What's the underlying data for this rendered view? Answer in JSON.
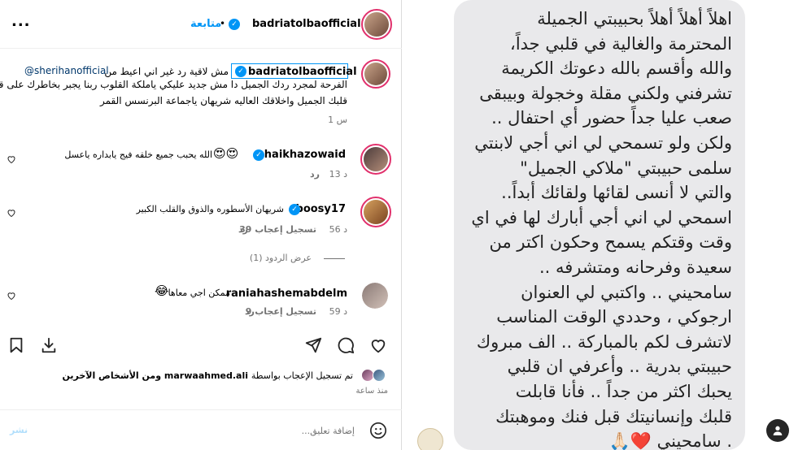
{
  "header": {
    "username": "badriatolbaofficial",
    "follow_label": "متابعة",
    "separator": "•",
    "more": "..."
  },
  "caption": {
    "username": "badriatolbaofficial",
    "mention": "@sherihanofficial",
    "line1": "مش لاقية رد غير اني اعيط من",
    "line2": "الفرحة لمجرد ردك الجميل دا مش جديد عليكي ياملكة القلوب ربنا يجبر بخاطرك على قد",
    "line3": "قلبك الجميل واخلاقك العاليه شريهان ياجماعة البرنسس القمر",
    "time": "1 س"
  },
  "comments": [
    {
      "username": "shaikhazowaid",
      "text": "الله يحبب جميع خلقه فيج يابداره ياعسل",
      "emoji": "😍😍",
      "time": "13 د",
      "reply": "رد",
      "likes": ""
    },
    {
      "username": "boosy17",
      "text": "شريهان الأسطوره والذوق والقلب الكبير",
      "emoji": "",
      "time": "56 د",
      "likes": "39 تسجيل إعجاب",
      "reply": "رد",
      "view_replies": "عرض الردود (1)"
    },
    {
      "username": "raniahashemabdelm",
      "text": "ممكن اجي معاها",
      "emoji": "😂",
      "time": "59 د",
      "likes": "9 تسجيل إعجاب",
      "reply": "رد"
    }
  ],
  "likes": {
    "prefix": "تم تسجيل الإعجاب بواسطة",
    "user": "marwaahmed.ali",
    "suffix": "ومن الأشخاص الآخرين",
    "time_ago": "منذ ساعة"
  },
  "comment_input": {
    "placeholder": "إضافة تعليق...",
    "post_label": "نشر"
  },
  "message": {
    "text": "اهلاً أهلاً أهلاً بحبيبتي الجميلة\nالمحترمة والغالية في قلبي جداً،\nوالله وأقسم بالله دعوتك الكريمة\nتشرفني ولكني مقلة وخجولة وبيبقى\nصعب عليا جداً حضور أي احتفال ..\nولكن ولو تسمحي لي اني أجي لابنتي\nسلمى حبيبتي \"ملاكي الجميل\"\nوالتي لا أنسى لقائها ولقائك أبداً..\nاسمحي لي اني أجي أبارك لها في اي\nوقت وقتكم يسمح وحكون اكتر من\nسعيدة وفرحانه ومتشرفه ..\nسامحيني .. واكتبي لي العنوان\nارجوكي ، وحددي الوقت المناسب\nلاتشرف لكم بالمباركة .. الف مبروك\nحبيبتي بدرية .. وأعرفي ان قلبي\nيحبك اكثر من جداً .. فأنا قابلت\nقلبك وإنسانيتك قبل فنك وموهبتك\n. سامحيني ❤️🙏🏻"
  },
  "colors": {
    "accent": "#0095f6",
    "ring": "#e1306c",
    "muted": "#737373",
    "bubble": "#e9e9eb"
  }
}
